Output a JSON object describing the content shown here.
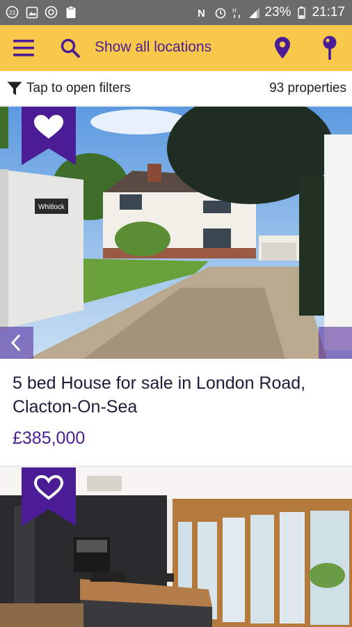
{
  "status_bar": {
    "left_icons": [
      "notification-count-icon",
      "image-icon",
      "sync-icon",
      "clipboard-icon"
    ],
    "notification_count": "23",
    "right_icons": [
      "nfc-icon",
      "alarm-icon",
      "data-icon",
      "signal-icon",
      "battery-icon"
    ],
    "battery": "23%",
    "time": "21:17"
  },
  "app_bar": {
    "location_label": "Show all locations",
    "icons": [
      "menu-icon",
      "search-icon",
      "location-pin-icon",
      "map-pin-icon"
    ]
  },
  "filters": {
    "label": "Tap to open filters",
    "count": "93 properties"
  },
  "listings": [
    {
      "title": "5 bed House for sale in London Road, Clacton-On-Sea",
      "price": "£385,000",
      "favourite": true,
      "photo_sign": "Whitlock"
    },
    {
      "title": "",
      "price": "",
      "favourite": false
    }
  ],
  "colors": {
    "accent_yellow": "#f7c84a",
    "brand_purple": "#4a1d96",
    "statusbar_grey": "#6b6b6b"
  }
}
